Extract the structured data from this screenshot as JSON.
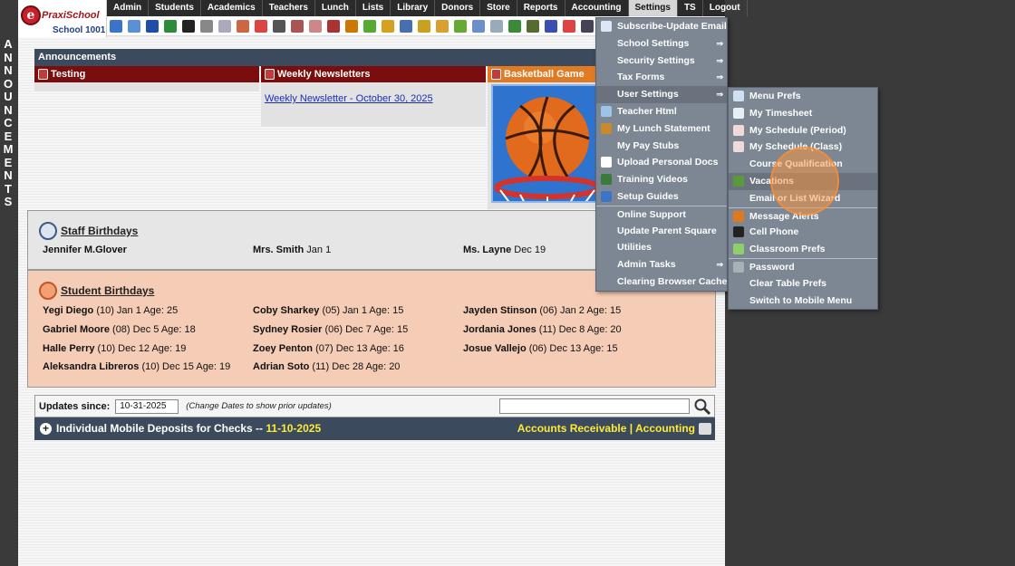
{
  "side_strip": {
    "letters": [
      "A",
      "N",
      "N",
      "O",
      "U",
      "N",
      "C",
      "E",
      "M",
      "E",
      "N",
      "T",
      "S"
    ]
  },
  "logo": {
    "badge": "e",
    "name": "PraxiSchool",
    "school": "School 1001"
  },
  "nav": {
    "items": [
      "Admin",
      "Students",
      "Academics",
      "Teachers",
      "Lunch",
      "Lists",
      "Library",
      "Donors",
      "Store",
      "Reports",
      "Accounting",
      "Settings",
      "TS",
      "Logout"
    ],
    "active": "Settings"
  },
  "announcements": {
    "header": "Announcements",
    "cards": [
      {
        "title": "Testing",
        "color": "#7a0d0d"
      },
      {
        "title": "Weekly Newsletters",
        "color": "#7a0d0d",
        "link": "Weekly Newsletter - October 30, 2025"
      },
      {
        "title": "Basketball Game",
        "color": "#e07b24"
      }
    ]
  },
  "staff_birthdays": {
    "heading": "Staff Birthdays",
    "entries": [
      {
        "name": "Jennifer M.Glover",
        "detail": ""
      },
      {
        "name": "Mrs. Smith",
        "detail": "Jan 1"
      },
      {
        "name": "Ms. Layne",
        "detail": "Dec 19"
      }
    ]
  },
  "student_birthdays": {
    "heading": "Student Birthdays",
    "entries": [
      {
        "name": "Yegi Diego",
        "detail": "(10) Jan 1 Age: 25"
      },
      {
        "name": "Coby Sharkey",
        "detail": "(05) Jan 1 Age: 15"
      },
      {
        "name": "Jayden Stinson",
        "detail": "(06) Jan 2 Age: 15"
      },
      {
        "name": "Gabriel Moore",
        "detail": "(08) Dec 5 Age: 18"
      },
      {
        "name": "Sydney Rosier",
        "detail": "(06) Dec 7 Age: 15"
      },
      {
        "name": "Jordania Jones",
        "detail": "(11) Dec 8 Age: 20"
      },
      {
        "name": "Halle Perry",
        "detail": "(10) Dec 12 Age: 19"
      },
      {
        "name": "Zoey Penton",
        "detail": "(07) Dec 13 Age: 16"
      },
      {
        "name": "Josue Vallejo",
        "detail": "(06) Dec 13 Age: 15"
      },
      {
        "name": "Aleksandra Libreros",
        "detail": "(10) Dec 15 Age: 19"
      },
      {
        "name": "Adrian Soto",
        "detail": "(11) Dec 28 Age: 20"
      }
    ]
  },
  "updates": {
    "label": "Updates since:",
    "date": "10-31-2025",
    "hint": "(Change Dates to show prior updates)",
    "search_value": ""
  },
  "deposit_bar": {
    "title": "Individual Mobile Deposits for Checks",
    "separator": "--",
    "date": "11-10-2025",
    "links": "Accounts Receivable | Accounting"
  },
  "settings_menu": {
    "items": [
      {
        "label": "Subscribe-Update Email",
        "icon": "mail-icon",
        "color": "#dde6f2",
        "arrow": false
      },
      {
        "label": "School Settings",
        "icon": "",
        "arrow": true
      },
      {
        "label": "Security Settings",
        "icon": "",
        "arrow": true
      },
      {
        "label": "Tax Forms",
        "icon": "",
        "arrow": true
      },
      {
        "label": "User Settings",
        "icon": "",
        "arrow": true,
        "highlighted": true
      },
      {
        "label": "Teacher Html",
        "icon": "html-icon",
        "color": "#9cc3ea",
        "arrow": false
      },
      {
        "label": "My Lunch Statement",
        "icon": "burger-icon",
        "color": "#c88a2a",
        "arrow": false
      },
      {
        "label": "My Pay Stubs",
        "icon": "",
        "arrow": false
      },
      {
        "label": "Upload Personal Docs",
        "icon": "document-icon",
        "color": "#ffffff",
        "arrow": false
      },
      {
        "label": "Training Videos",
        "icon": "film-icon",
        "color": "#3a7a3a",
        "arrow": false
      },
      {
        "label": "Setup Guides",
        "icon": "help-icon",
        "color": "#3b75c9",
        "arrow": false
      },
      {
        "label": "Online Support",
        "icon": "",
        "arrow": false,
        "separator": true
      },
      {
        "label": "Update Parent Square",
        "icon": "",
        "arrow": false
      },
      {
        "label": "Utilities",
        "icon": "",
        "arrow": false
      },
      {
        "label": "Admin Tasks",
        "icon": "",
        "arrow": true
      },
      {
        "label": "Clearing Browser Cache",
        "icon": "",
        "arrow": false
      }
    ]
  },
  "user_settings_menu": {
    "items": [
      {
        "label": "Menu Prefs",
        "icon": "grid-icon",
        "color": "#cfe0f2"
      },
      {
        "label": "My Timesheet",
        "icon": "clock-icon",
        "color": "#e8eef5"
      },
      {
        "label": "My Schedule (Period)",
        "icon": "calendar-icon",
        "color": "#f0d9d9"
      },
      {
        "label": "My Schedule (Class)",
        "icon": "calendar-icon",
        "color": "#f0d9d9"
      },
      {
        "label": "Course Qualification",
        "icon": ""
      },
      {
        "label": "Vacations",
        "icon": "palm-tree-icon",
        "color": "#5a9a3a",
        "highlighted": true
      },
      {
        "label": "Email or List Wizard",
        "icon": ""
      },
      {
        "label": "Message Alerts",
        "icon": "alert-cone-icon",
        "color": "#e0781f",
        "separator": true
      },
      {
        "label": "Cell Phone",
        "icon": "phone-icon",
        "color": "#222222"
      },
      {
        "label": "Classroom Prefs",
        "icon": "classroom-icon",
        "color": "#8fcf6a"
      },
      {
        "label": "Password",
        "icon": "key-icon",
        "color": "#aab0b8",
        "separator": true
      },
      {
        "label": "Clear Table Prefs",
        "icon": ""
      },
      {
        "label": "Switch to Mobile Menu",
        "icon": ""
      }
    ]
  }
}
